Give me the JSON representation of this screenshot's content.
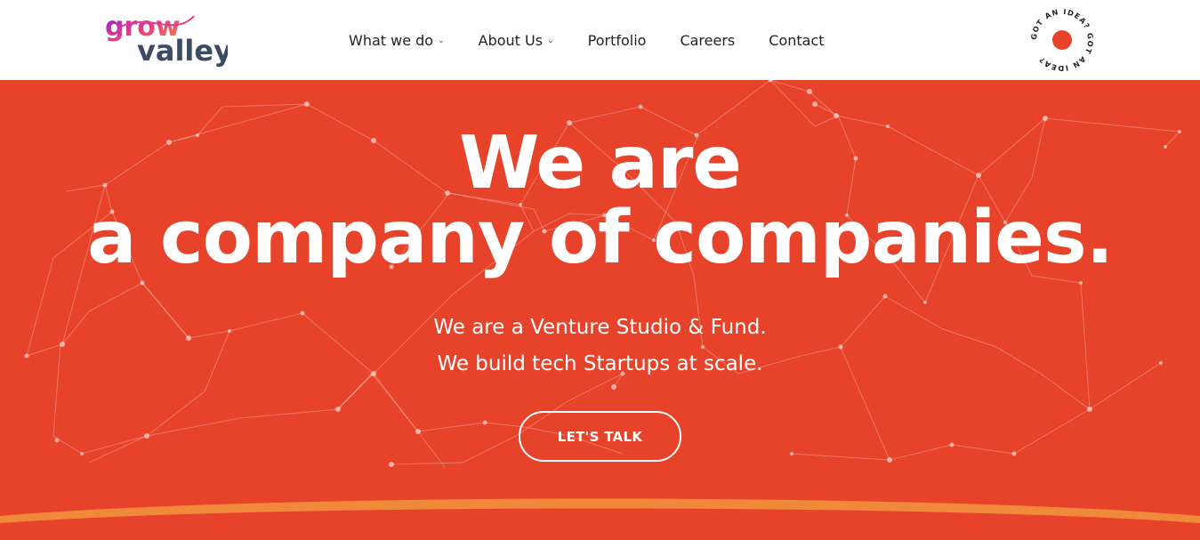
{
  "brand": {
    "logo_text_top": "grow",
    "logo_text_bottom": "valley",
    "colors": {
      "hero_bg": "#e7432a",
      "accent_orange": "#f08a3a",
      "logo_dark": "#3c4a63",
      "logo_purple": "#7b2bd6",
      "logo_pink": "#e23a8b"
    }
  },
  "nav": {
    "items": [
      {
        "label": "What we do",
        "has_dropdown": true,
        "icon": "chevron-down-icon"
      },
      {
        "label": "About Us",
        "has_dropdown": true,
        "icon": "chevron-down-icon"
      },
      {
        "label": "Portfolio",
        "has_dropdown": false
      },
      {
        "label": "Careers",
        "has_dropdown": false
      },
      {
        "label": "Contact",
        "has_dropdown": false
      }
    ]
  },
  "idea_badge": {
    "ring_text": "GOT AN IDEA? GOT AN IDEA?",
    "dot_color": "#e7432a"
  },
  "hero": {
    "title_line1": "We are",
    "title_line2": "a company of companies.",
    "subtitle_line1": "We are a Venture Studio & Fund.",
    "subtitle_line2": "We build tech Startups at scale.",
    "cta_label": "LET'S TALK"
  }
}
